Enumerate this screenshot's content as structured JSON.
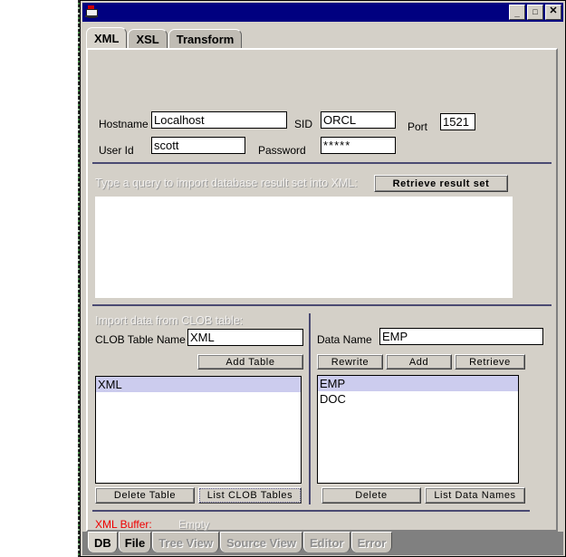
{
  "window": {
    "icon": "java-coffee-cup-icon",
    "title": "",
    "minimize_label": "_",
    "maximize_label": "□",
    "close_label": "✕"
  },
  "top_tabs": [
    {
      "label": "XML",
      "selected": true
    },
    {
      "label": "XSL",
      "selected": false
    },
    {
      "label": "Transform",
      "selected": false
    }
  ],
  "connection": {
    "hostname_label": "Hostname",
    "hostname_value": "Localhost",
    "sid_label": "SID",
    "sid_value": "ORCL",
    "port_label": "Port",
    "port_value": "1521",
    "userid_label": "User Id",
    "userid_value": "scott",
    "password_label": "Password",
    "password_value": "*****"
  },
  "query": {
    "prompt": "Type a query to import database result set into XML:",
    "retrieve_button": "Retrieve result set",
    "textarea_value": ""
  },
  "clob": {
    "section_label": "Import data from CLOB table:",
    "table_name_label": "CLOB Table Name",
    "table_name_value": "XML",
    "add_table_button": "Add Table",
    "tables": [
      {
        "name": "XML",
        "selected": true
      }
    ],
    "delete_table_button": "Delete Table",
    "list_clob_tables_button": "List CLOB Tables"
  },
  "data": {
    "data_name_label": "Data Name",
    "data_name_value": "EMP",
    "rewrite_button": "Rewrite",
    "add_button": "Add",
    "retrieve_button": "Retrieve",
    "names": [
      {
        "name": "EMP",
        "selected": true
      },
      {
        "name": "DOC",
        "selected": false
      }
    ],
    "delete_button": "Delete",
    "list_data_names_button": "List Data Names"
  },
  "status": {
    "buffer_label": "XML Buffer:",
    "buffer_value": "Empty",
    "buffer_label_color": "#ee0000",
    "buffer_value_color": "#f2f0ee"
  },
  "bottom_tabs": [
    {
      "label": "DB",
      "selected": true,
      "enabled": true
    },
    {
      "label": "File",
      "selected": false,
      "enabled": true
    },
    {
      "label": "Tree View",
      "selected": false,
      "enabled": false
    },
    {
      "label": "Source View",
      "selected": false,
      "enabled": false
    },
    {
      "label": "Editor",
      "selected": false,
      "enabled": false
    },
    {
      "label": "Error",
      "selected": false,
      "enabled": false
    }
  ]
}
